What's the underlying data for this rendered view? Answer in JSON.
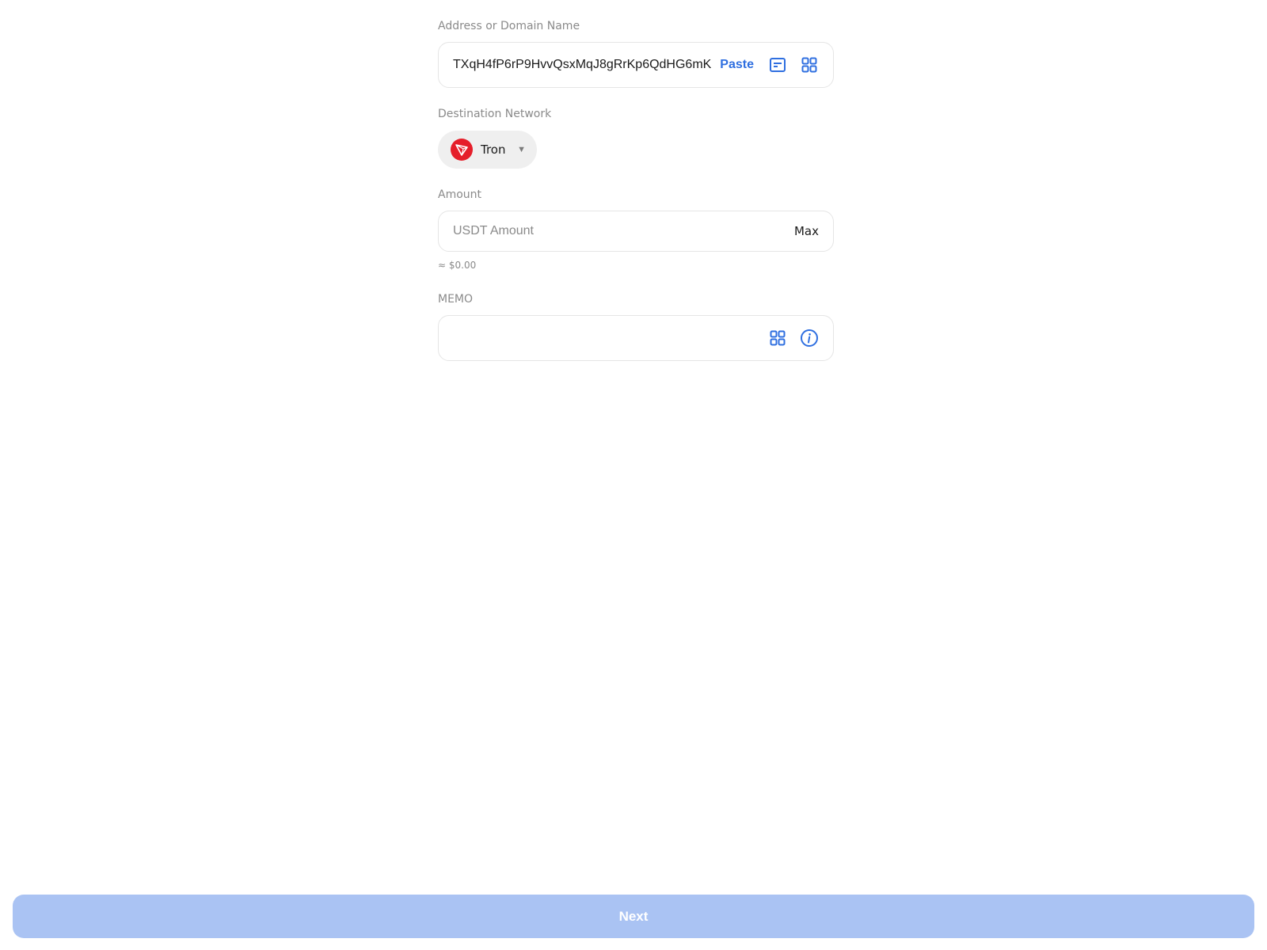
{
  "address": {
    "label": "Address or Domain Name",
    "value": "TXqH4fP6rP9HvvQsxMqJ8gRrKp6QdHG6mK",
    "paste_label": "Paste"
  },
  "network": {
    "label": "Destination Network",
    "selected": "Tron",
    "logo_color": "#e51e2a"
  },
  "amount": {
    "label": "Amount",
    "placeholder": "USDT Amount",
    "max_label": "Max",
    "fiat_estimate": "≈ $0.00"
  },
  "memo": {
    "label": "MEMO",
    "value": ""
  },
  "footer": {
    "next_label": "Next"
  },
  "colors": {
    "accent": "#2f6fe0",
    "next_disabled": "#aac3f3"
  }
}
